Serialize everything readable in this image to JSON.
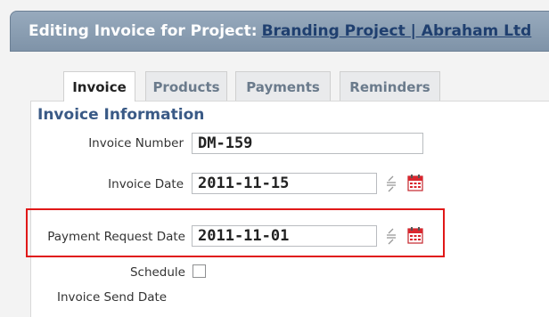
{
  "header": {
    "prefix": "Editing Invoice for Project:",
    "project_link": "Branding Project | Abraham Ltd"
  },
  "tabs": [
    {
      "label": "Invoice",
      "active": true
    },
    {
      "label": "Products",
      "active": false
    },
    {
      "label": "Payments",
      "active": false
    },
    {
      "label": "Reminders",
      "active": false
    }
  ],
  "section": {
    "title": "Invoice Information"
  },
  "form": {
    "invoice_number": {
      "label": "Invoice Number",
      "value": "DM-159"
    },
    "invoice_date": {
      "label": "Invoice Date",
      "value": "2011-11-15"
    },
    "payment_request_date": {
      "label": "Payment Request Date",
      "value": "2011-11-01"
    },
    "schedule": {
      "label": "Schedule",
      "checked": false
    },
    "invoice_send_date": {
      "label": "Invoice Send Date"
    }
  },
  "colors": {
    "header_bg": "#8ea1b5",
    "highlight_border": "#e01818",
    "section_title": "#3a5a86",
    "calendar_red": "#d9262e"
  },
  "icons": [
    "sort-icon",
    "calendar-icon"
  ]
}
